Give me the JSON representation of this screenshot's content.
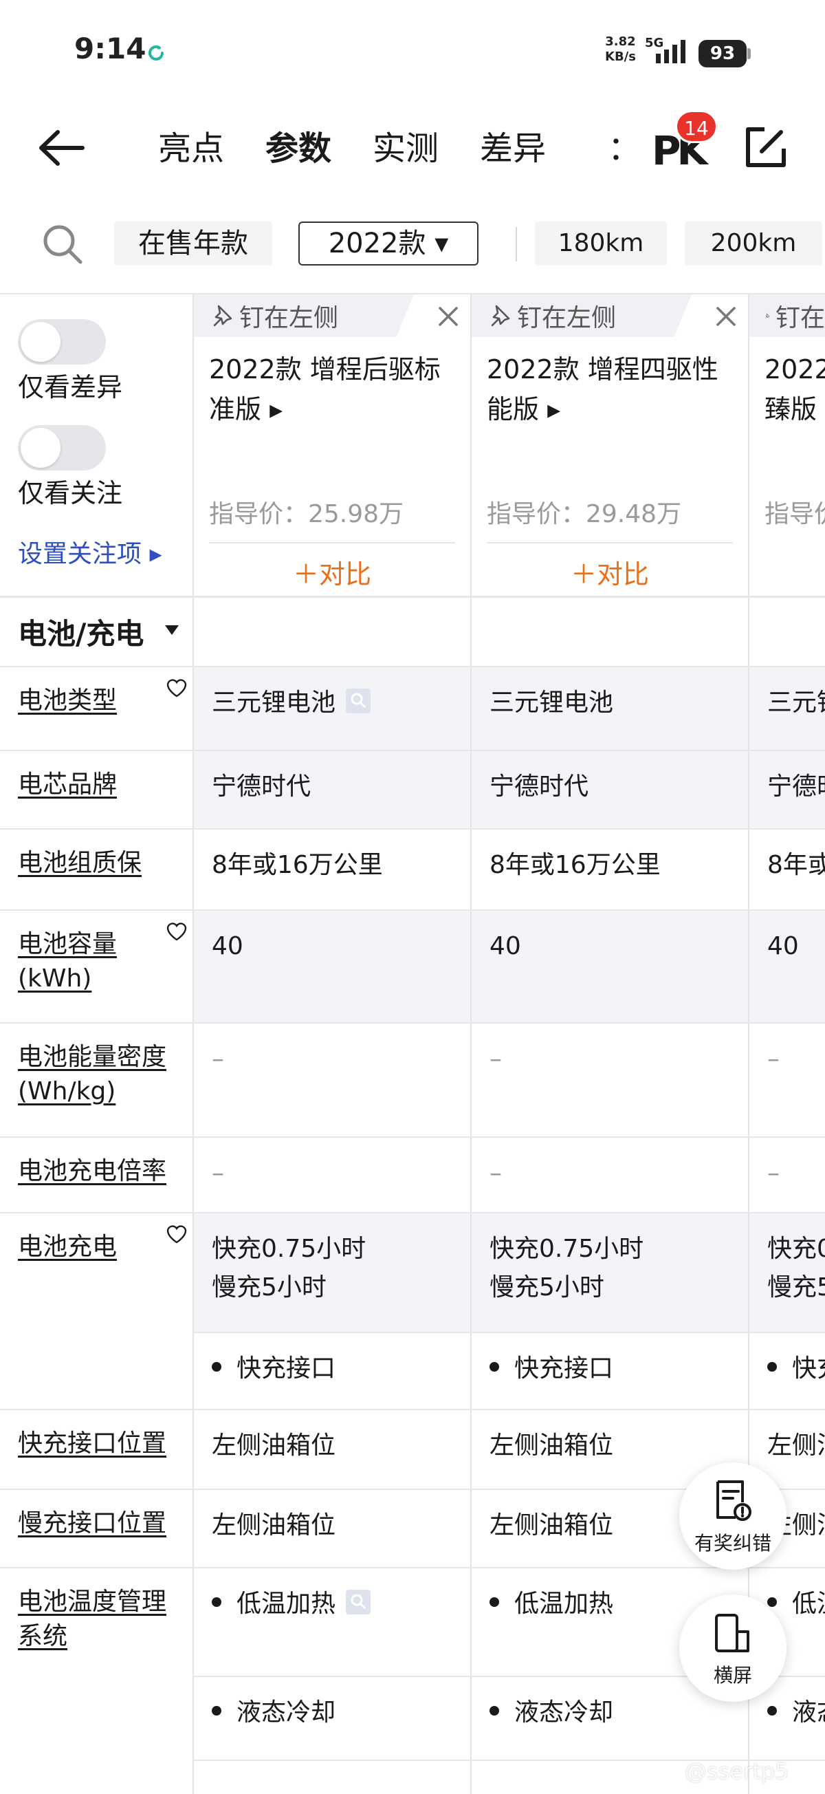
{
  "status_bar": {
    "time": "9:14",
    "net_speed_value": "3.82",
    "net_speed_unit": "KB/s",
    "network_type": "5G",
    "battery": "93"
  },
  "header": {
    "tabs": [
      {
        "label": "亮点",
        "active": false
      },
      {
        "label": "参数",
        "active": true
      },
      {
        "label": "实测",
        "active": false
      },
      {
        "label": "差异",
        "active": false
      }
    ],
    "more_tab": "：",
    "pk_label": "PK",
    "pk_badge": "14"
  },
  "filter": {
    "on_sale": "在售年款",
    "year_selected": "2022款 ▾",
    "range_1": "180km",
    "range_2": "200km"
  },
  "left_controls": {
    "diff_only": "仅看差异",
    "focus_only": "仅看关注",
    "settings_link": "设置关注项 ▸"
  },
  "models": [
    {
      "pin_label": "钉在左侧",
      "name": "2022款 增程后驱标准版 ▸",
      "price": "指导价：25.98万",
      "compare": "＋对比"
    },
    {
      "pin_label": "钉在左侧",
      "name": "2022款 增程四驱性能版 ▸",
      "price": "指导价：29.48万",
      "compare": "＋对比"
    },
    {
      "pin_label": "钉在",
      "name": "2022 臻版",
      "price": "指导价",
      "compare": ""
    }
  ],
  "section": {
    "title": "电池/充电"
  },
  "rows": {
    "battery_type": {
      "label": "电池类型",
      "values": [
        "三元锂电池",
        "三元锂电池",
        "三元锂"
      ]
    },
    "cell_brand": {
      "label": "电芯品牌",
      "values": [
        "宁德时代",
        "宁德时代",
        "宁德时"
      ]
    },
    "battery_warranty": {
      "label": "电池组质保",
      "values": [
        "8年或16万公里",
        "8年或16万公里",
        "8年或"
      ]
    },
    "battery_capacity": {
      "label": "电池容量(kWh)",
      "values": [
        "40",
        "40",
        "40"
      ]
    },
    "energy_density": {
      "label": "电池能量密度(Wh/kg)",
      "values": [
        "–",
        "–",
        "–"
      ]
    },
    "charge_rate": {
      "label": "电池充电倍率",
      "values": [
        "–",
        "–",
        "–"
      ]
    },
    "charging": {
      "label": "电池充电",
      "fast": [
        "快充0.75小时",
        "快充0.75小时",
        "快充0"
      ],
      "slow": [
        "慢充5小时",
        "慢充5小时",
        "慢充5"
      ],
      "port": [
        "快充接口",
        "快充接口",
        "快充"
      ]
    },
    "fast_port_pos": {
      "label": "快充接口位置",
      "values": [
        "左侧油箱位",
        "左侧油箱位",
        "左侧油"
      ]
    },
    "slow_port_pos": {
      "label": "慢充接口位置",
      "values": [
        "左侧油箱位",
        "左侧油箱位",
        "左侧油"
      ]
    },
    "thermal_mgmt": {
      "label": "电池温度管理系统",
      "heating": [
        "低温加热",
        "低温加热",
        "低温"
      ],
      "cooling": [
        "液态冷却",
        "液态冷却",
        "液态"
      ]
    }
  },
  "fabs": {
    "feedback": "有奖纠错",
    "landscape": "横屏"
  },
  "watermark": "@ssertp5",
  "colors": {
    "accent_orange": "#e8701a",
    "link_blue": "#2f4fbf",
    "badge_red": "#e8322a",
    "tab_highlight": "#ffcf4d",
    "shaded_row": "#f2f4f8"
  }
}
